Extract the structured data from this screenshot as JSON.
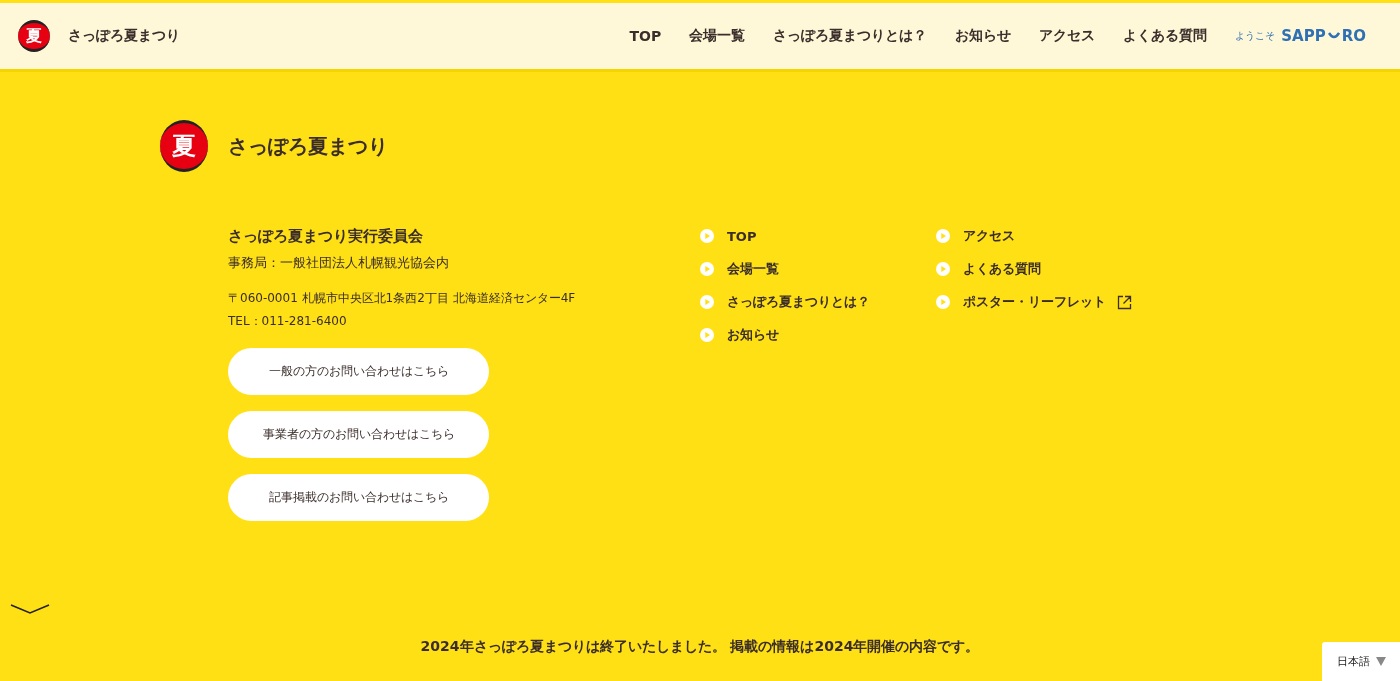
{
  "header": {
    "logo_char": "夏",
    "title": "さっぽろ夏まつり",
    "nav": [
      {
        "label": "TOP"
      },
      {
        "label": "会場一覧"
      },
      {
        "label": "さっぽろ夏まつりとは？"
      },
      {
        "label": "お知らせ"
      },
      {
        "label": "アクセス"
      },
      {
        "label": "よくある質問"
      }
    ],
    "partner_logo": {
      "greeting": "ようこそ",
      "word_start": "SAPP",
      "word_end": "RO"
    }
  },
  "footer": {
    "logo_char": "夏",
    "title": "さっぽろ夏まつり",
    "org_name": "さっぽろ夏まつり実行委員会",
    "office": "事務局：一般社団法人札幌観光協会内",
    "address": "〒060-0001 札幌市中央区北1条西2丁目 北海道経済センター4F",
    "tel": "TEL：011-281-6400",
    "buttons": [
      "一般の方のお問い合わせはこちら",
      "事業者の方のお問い合わせはこちら",
      "記事掲載のお問い合わせはこちら"
    ],
    "link_columns": [
      [
        {
          "label": "TOP",
          "external": false
        },
        {
          "label": "会場一覧",
          "external": false
        },
        {
          "label": "さっぽろ夏まつりとは？",
          "external": false
        },
        {
          "label": "お知らせ",
          "external": false
        }
      ],
      [
        {
          "label": "アクセス",
          "external": false
        },
        {
          "label": "よくある質問",
          "external": false
        },
        {
          "label": "ポスター・リーフレット",
          "external": true
        }
      ]
    ]
  },
  "notice": "2024年さっぽろ夏まつりは終了いたしました。 掲載の情報は2024年開催の内容です。",
  "language_selector": {
    "value": "日本語"
  }
}
